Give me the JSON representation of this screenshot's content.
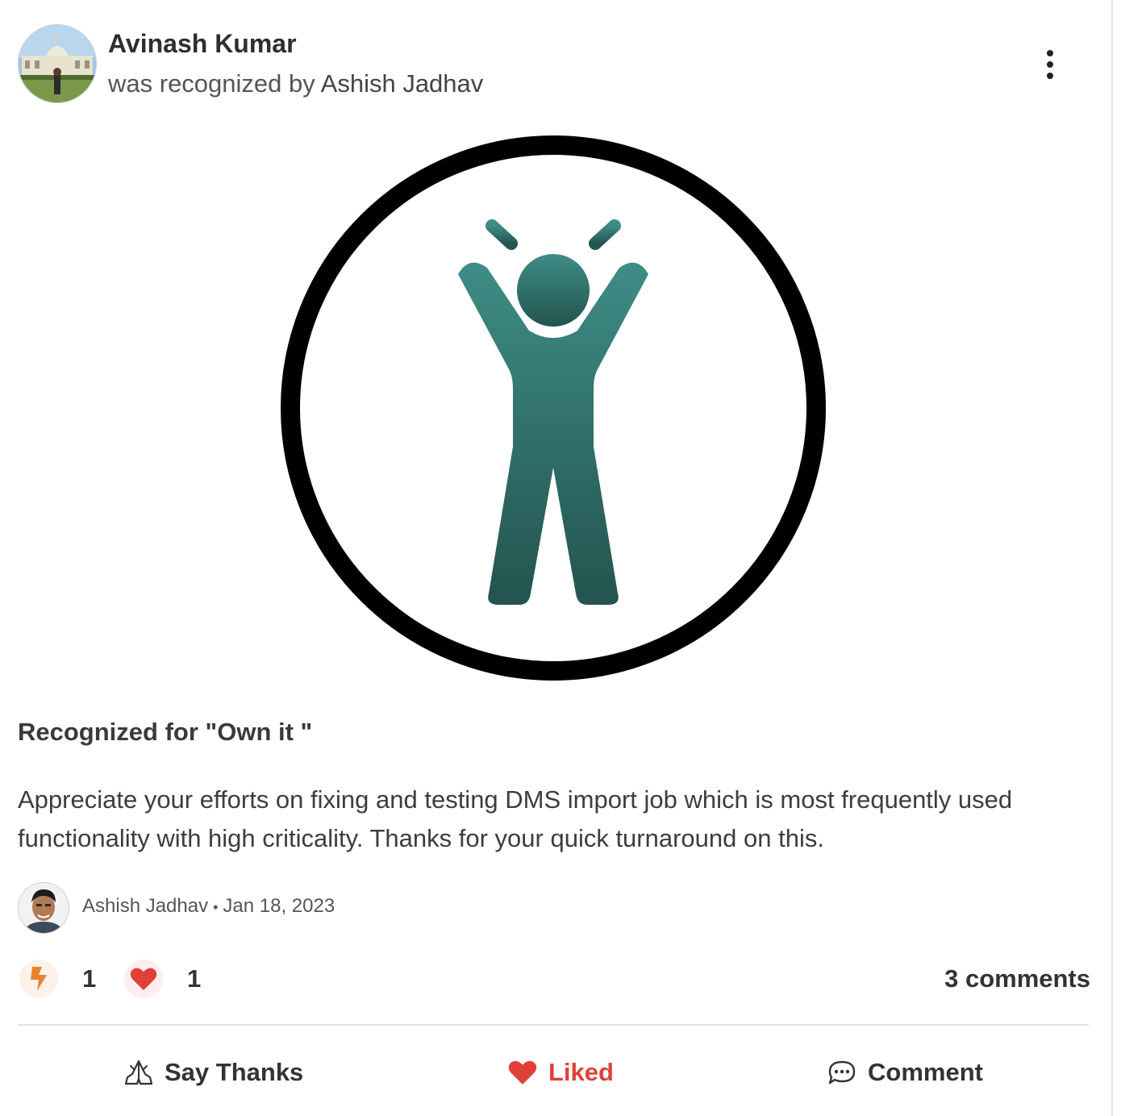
{
  "post": {
    "recipient_name": "Avinash Kumar",
    "subtitle_prefix": "was recognized by",
    "recognizer_name": "Ashish Jadhav",
    "badge_icon": "arms-raised-person-icon",
    "reason": "Recognized for \"Own it \"",
    "message": "Appreciate your efforts on fixing and testing DMS import job which is most frequently used functionality with high criticality. Thanks for your quick turnaround on this.",
    "author_name": "Ashish Jadhav",
    "author_separator": "•",
    "date": "Jan 18, 2023"
  },
  "reactions": {
    "boost_count": "1",
    "like_count": "1",
    "comments_label": "3 comments"
  },
  "actions": {
    "say_thanks": "Say Thanks",
    "liked": "Liked",
    "comment": "Comment"
  },
  "colors": {
    "badge_teal_top": "#3c8a84",
    "badge_teal_bottom": "#245650",
    "like_red": "#e0403a",
    "boost_orange": "#e8822e"
  }
}
